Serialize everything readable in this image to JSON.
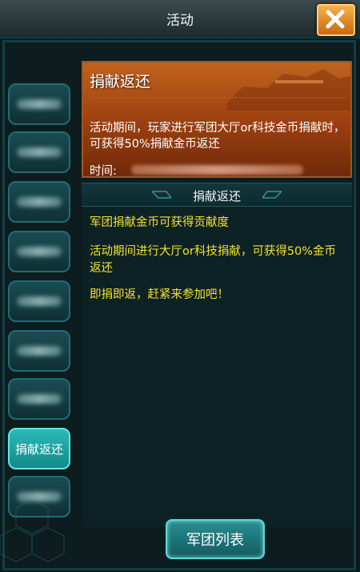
{
  "window": {
    "title": "活动"
  },
  "sidebar": {
    "tabs": [
      {
        "label": "",
        "active": false
      },
      {
        "label": "",
        "active": false
      },
      {
        "label": "",
        "active": false
      },
      {
        "label": "",
        "active": false
      },
      {
        "label": "",
        "active": false
      },
      {
        "label": "",
        "active": false
      },
      {
        "label": "",
        "active": false
      },
      {
        "label": "捐献返还",
        "active": true
      },
      {
        "label": "",
        "active": false
      }
    ]
  },
  "banner": {
    "title": "捐献返还",
    "description": "活动期间，玩家进行军团大厅or科技金币捐献时，可获得50%捐献金币返还",
    "time_label": "时间:"
  },
  "section": {
    "title": "捐献返还"
  },
  "content": {
    "paragraphs": [
      "军团捐献金币可获得贡献度",
      "活动期间进行大厅or科技捐献，可获得50%金币返还",
      "即捐即返，赶紧来参加吧！"
    ]
  },
  "footer": {
    "button_label": "军团列表"
  },
  "colors": {
    "accent_text": "#f3e22c",
    "banner_orange": "#c0631e",
    "active_tab": "#2bbab8"
  }
}
